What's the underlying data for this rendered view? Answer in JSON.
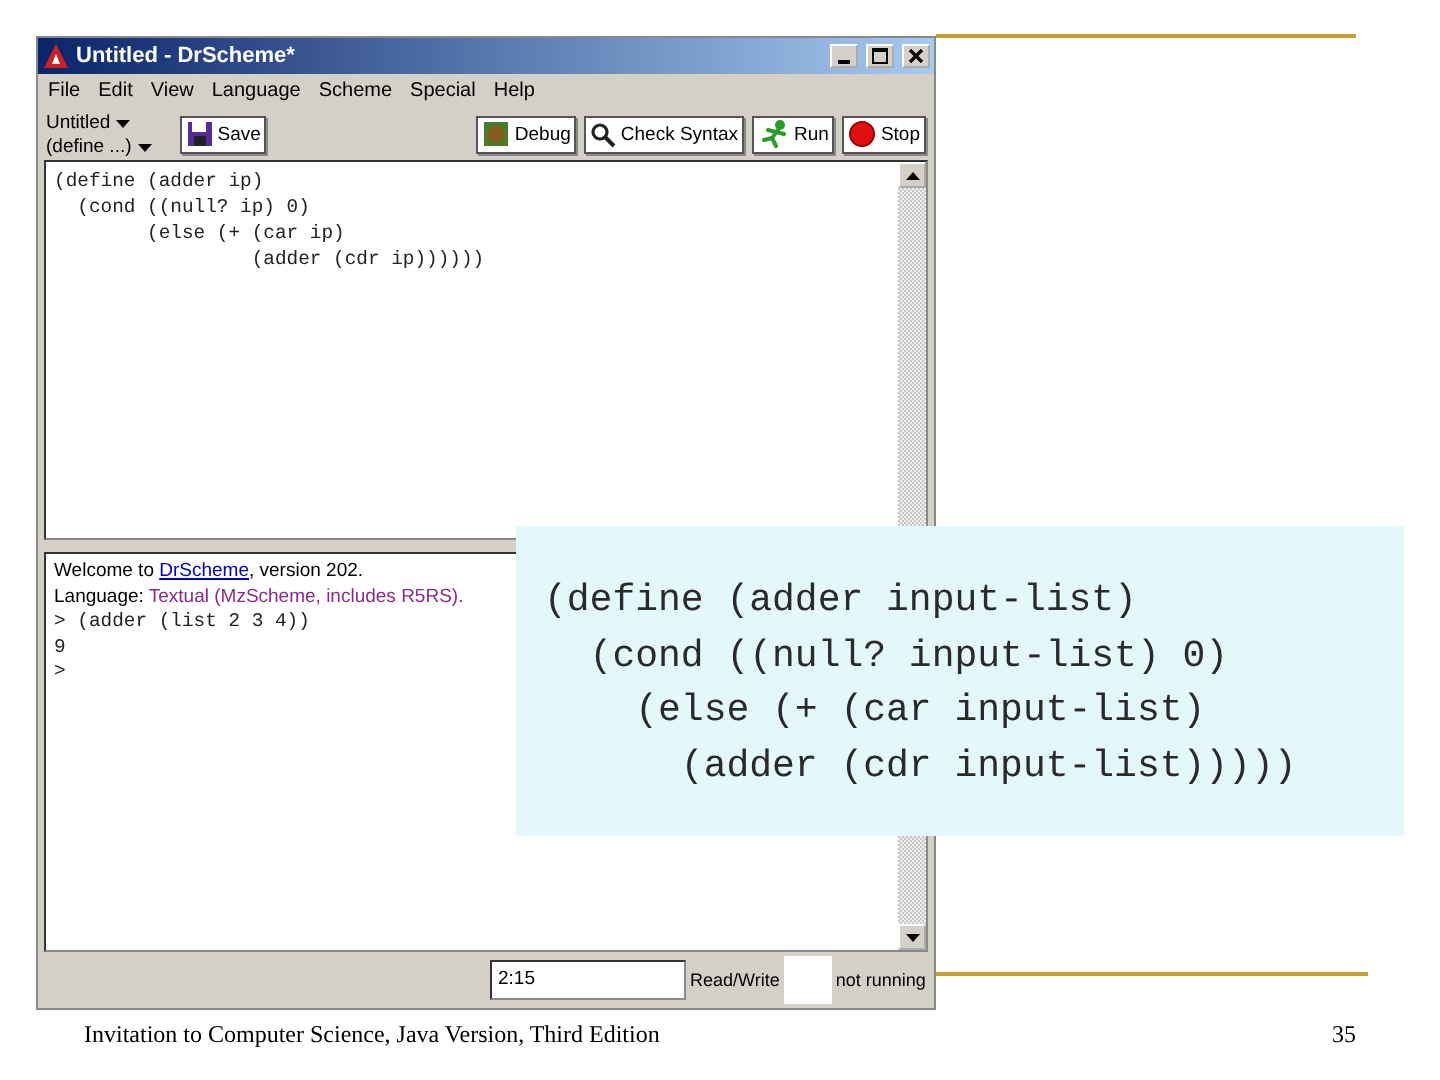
{
  "window": {
    "title": "Untitled - DrScheme*"
  },
  "menu": [
    "File",
    "Edit",
    "View",
    "Language",
    "Scheme",
    "Special",
    "Help"
  ],
  "toolbar": {
    "file_menu": "Untitled",
    "definitions_menu": "(define ...)",
    "buttons": [
      {
        "label": "Save",
        "kind": "save"
      },
      {
        "label": "Debug",
        "kind": "debug"
      },
      {
        "label": "Check Syntax",
        "kind": "check"
      },
      {
        "label": "Run",
        "kind": "run"
      },
      {
        "label": "Stop",
        "kind": "stop"
      }
    ]
  },
  "editor": {
    "lines": [
      "(define (adder ip)",
      "  (cond ((null? ip) 0)",
      "        (else (+ (car ip)",
      "                 (adder (cdr ip))))))"
    ]
  },
  "interactions": {
    "welcome": {
      "before": "Welcome to ",
      "link": "DrScheme",
      "after": ", version 202."
    },
    "language": {
      "label": "Language: ",
      "value": "Textual (MzScheme, includes R5RS)."
    },
    "lines": [
      "> (adder (list 2 3 4))",
      "9",
      ">"
    ]
  },
  "status_bar": {
    "position": "2:15",
    "mode": "Read/Write",
    "state": "not running"
  },
  "callout": {
    "lines": [
      "(define (adder input-list)",
      "  (cond ((null? input-list) 0)",
      "    (else (+ (car input-list)",
      "      (adder (cdr input-list)))))"
    ]
  },
  "slide": {
    "footer": "Invitation to Computer Science, Java Version, Third Edition",
    "page_number": "35"
  }
}
